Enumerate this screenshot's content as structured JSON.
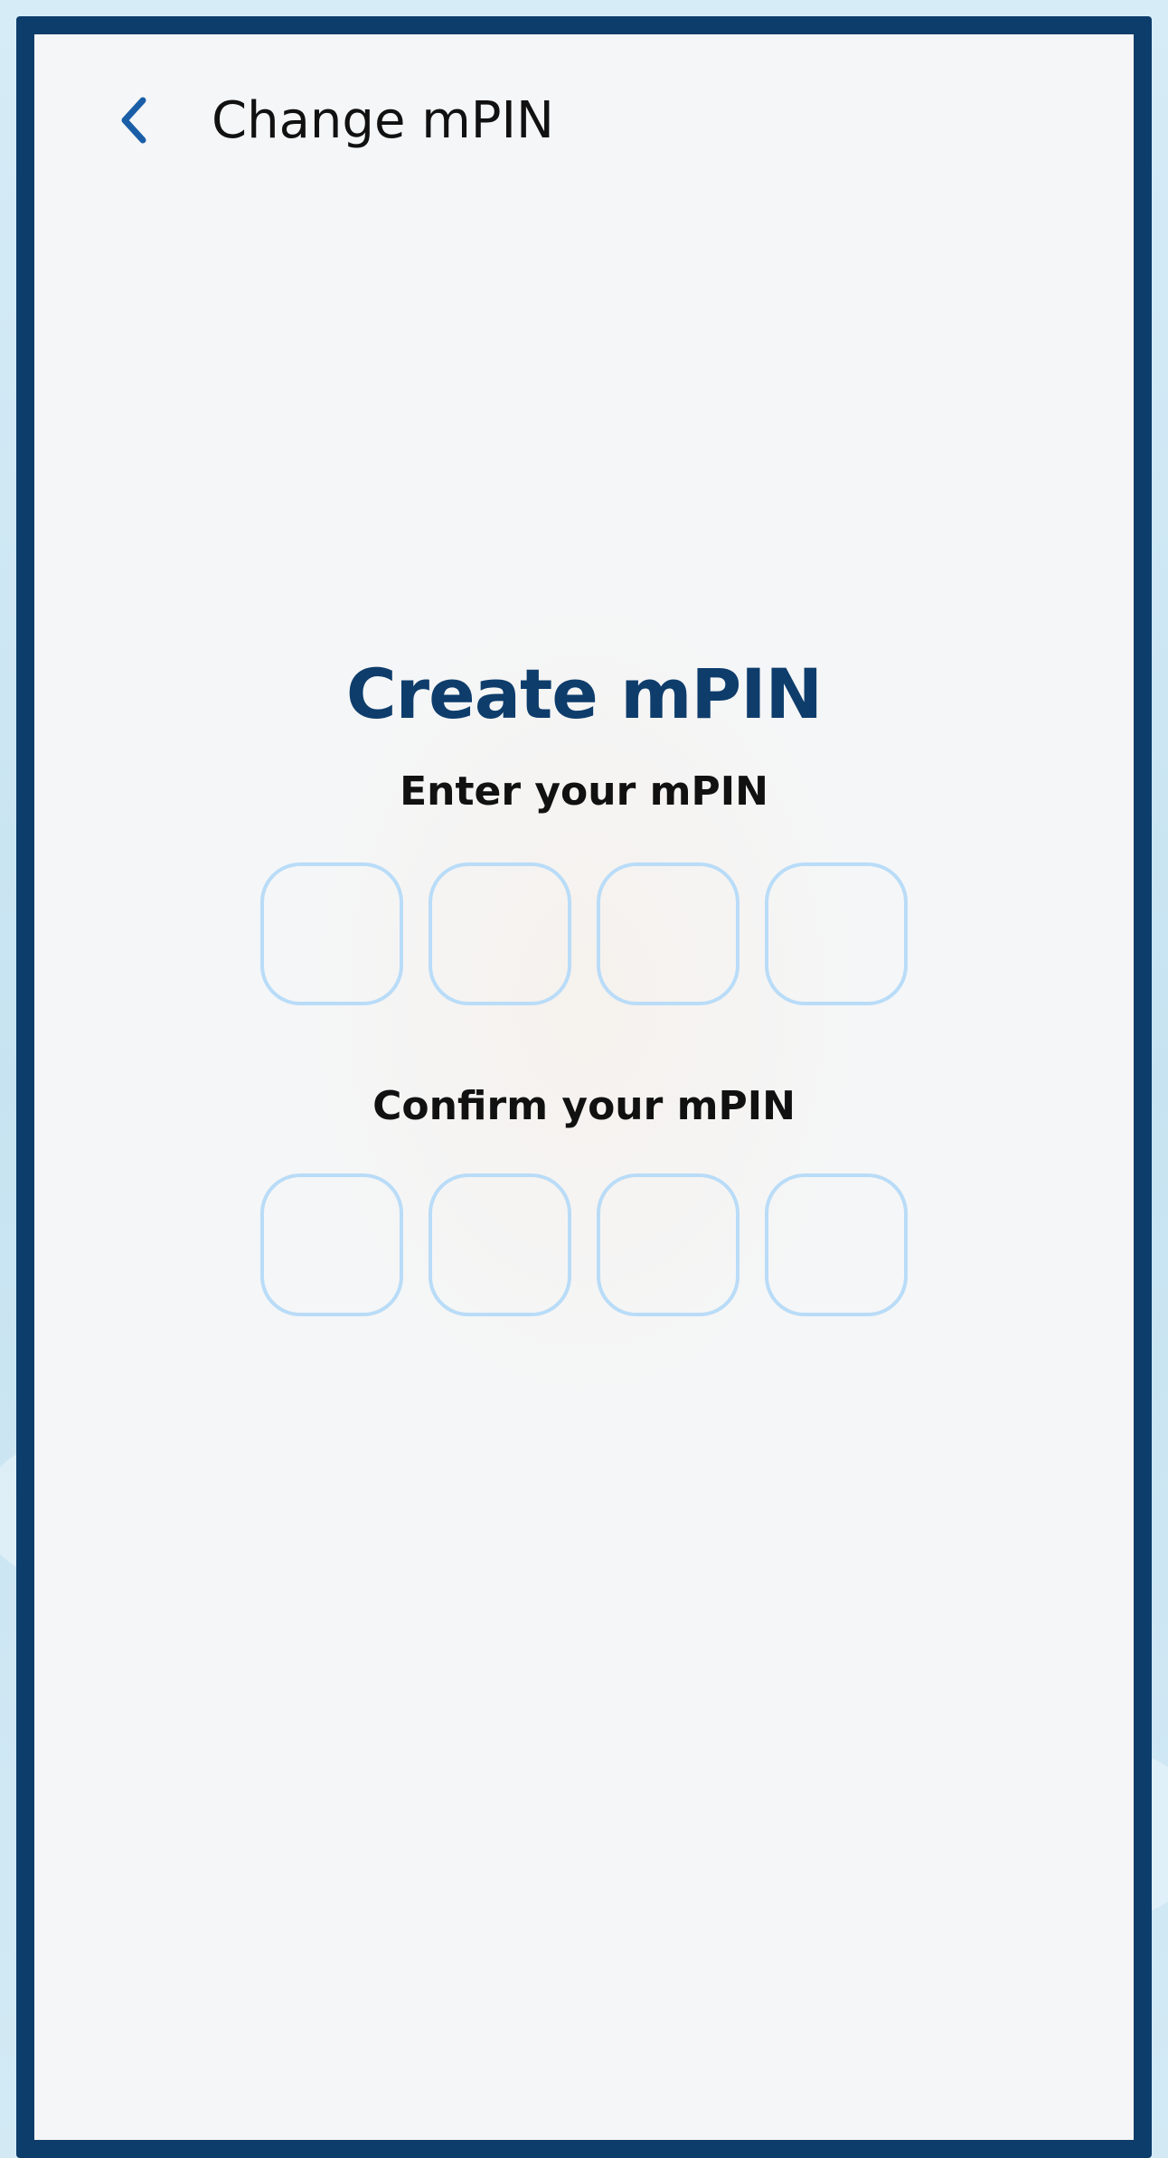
{
  "header": {
    "back_icon": "chevron-left-icon",
    "title": "Change mPIN"
  },
  "main": {
    "heading": "Create mPIN",
    "enter_label": "Enter your mPIN",
    "confirm_label": "Confirm your mPIN",
    "enter_pin_digits": [
      "",
      "",
      "",
      ""
    ],
    "confirm_pin_digits": [
      "",
      "",
      "",
      ""
    ]
  },
  "colors": {
    "frame": "#0d3d6b",
    "heading": "#0e3d6c",
    "back_icon": "#1a5ea8",
    "pin_border": "#b9dcf8",
    "screen_bg": "#f5f6f7"
  }
}
